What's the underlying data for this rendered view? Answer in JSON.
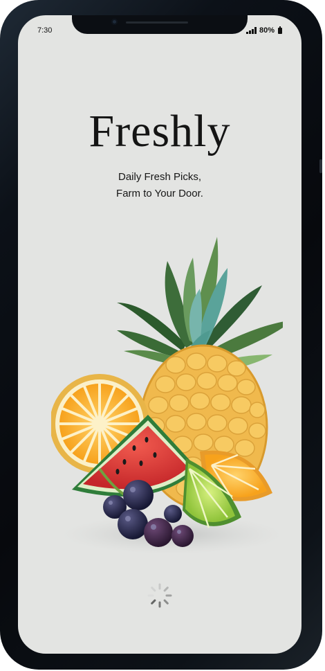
{
  "status_bar": {
    "time": "7:30",
    "battery_percent": "80%"
  },
  "app": {
    "name": "Freshly",
    "tagline_line1": "Daily Fresh Picks,",
    "tagline_line2": "Farm to Your Door."
  },
  "illustration": {
    "icon": "fruit-basket-illustration",
    "items": [
      "pineapple",
      "orange-slice",
      "watermelon-slice",
      "lime-slice",
      "orange-wedge",
      "blackcurrants"
    ]
  },
  "loading": {
    "icon": "loading-spinner-icon"
  },
  "colors": {
    "screen_background": "#e3e4e2",
    "text": "#141414"
  }
}
